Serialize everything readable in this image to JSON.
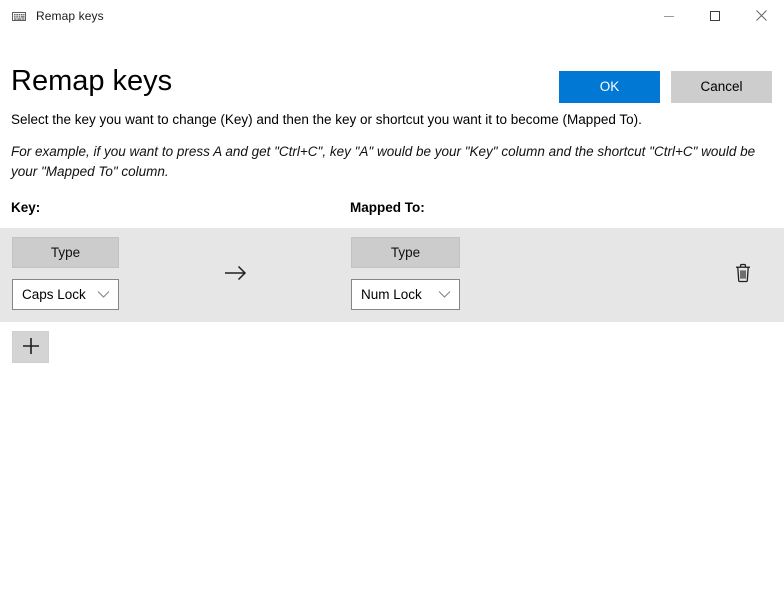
{
  "window": {
    "icon": "keyboard-icon",
    "title": "Remap keys",
    "controls": {
      "minimize": "minimize-icon",
      "maximize": "maximize-icon",
      "close": "close-icon"
    }
  },
  "header": {
    "page_title": "Remap keys",
    "ok_label": "OK",
    "cancel_label": "Cancel",
    "accent_color": "#0078d4",
    "secondary_color": "#cdcdcd"
  },
  "instructions": {
    "primary": "Select the key you want to change (Key) and then the key or shortcut you want it to become (Mapped To).",
    "example": "For example, if you want to press A and get \"Ctrl+C\", key \"A\" would be your \"Key\" column and the shortcut \"Ctrl+C\" would be your \"Mapped To\" column."
  },
  "columns": {
    "key_heading": "Key:",
    "mapped_heading": "Mapped To:"
  },
  "rows": [
    {
      "key": {
        "type_label": "Type",
        "selected": "Caps Lock",
        "chevron": "chevron-down-icon"
      },
      "arrow": "arrow-right-icon",
      "mapped": {
        "type_label": "Type",
        "selected": "Num Lock",
        "chevron": "chevron-down-icon"
      },
      "delete": "trash-icon"
    }
  ],
  "add_row": {
    "icon": "plus-icon"
  }
}
